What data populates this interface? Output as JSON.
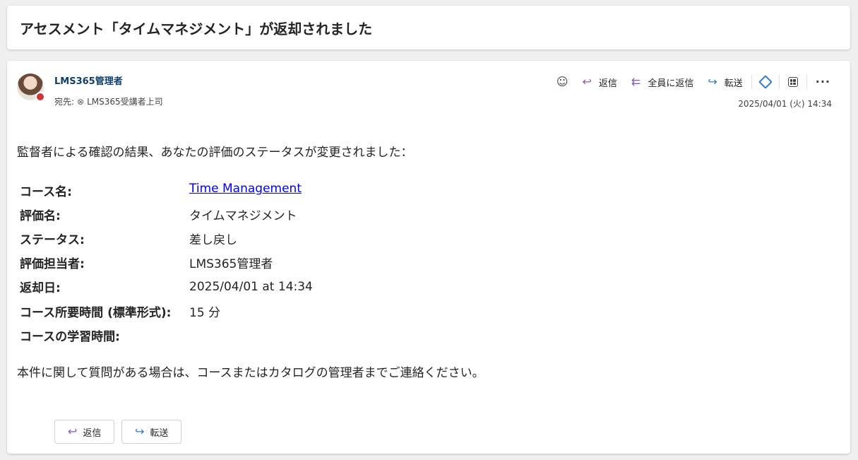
{
  "subject": "アセスメント「タイムマネジメント」が返却されました",
  "header": {
    "sender": "LMS365管理者",
    "to_label": "宛先:",
    "recipient": "LMS365受講者上司",
    "date": "2025/04/01 (火) 14:34"
  },
  "toolbar": {
    "reply": "返信",
    "reply_all": "全員に返信",
    "forward": "転送"
  },
  "body": {
    "intro": "監督者による確認の結果、あなたの評価のステータスが変更されました：",
    "rows": [
      {
        "label": "コース名:",
        "value": "Time Management"
      },
      {
        "label": "評価名:",
        "value": "タイムマネジメント"
      },
      {
        "label": "ステータス:",
        "value": "差し戻し"
      },
      {
        "label": "評価担当者:",
        "value": "LMS365管理者"
      },
      {
        "label": "返却日:",
        "value": "2025/04/01 at 14:34"
      },
      {
        "label": "コース所要時間 (標準形式):",
        "value": "15 分"
      },
      {
        "label": "コースの学習時間:",
        "value": ""
      }
    ],
    "outro": "本件に関して質問がある場合は、コースまたはカタログの管理者までご連絡ください。"
  },
  "actions": {
    "reply": "返信",
    "forward": "転送"
  },
  "colors": {
    "sender": "#0f3f6b",
    "link": "#0000ee",
    "presence": "#d13438",
    "reply_icon": "#8a5bb8",
    "forward_icon": "#2f7bd1"
  },
  "icons": [
    "emoji-icon",
    "reply-icon",
    "reply-all-icon",
    "forward-icon",
    "copilot-icon",
    "apps-icon",
    "more-icon",
    "remove-recipient-icon"
  ]
}
